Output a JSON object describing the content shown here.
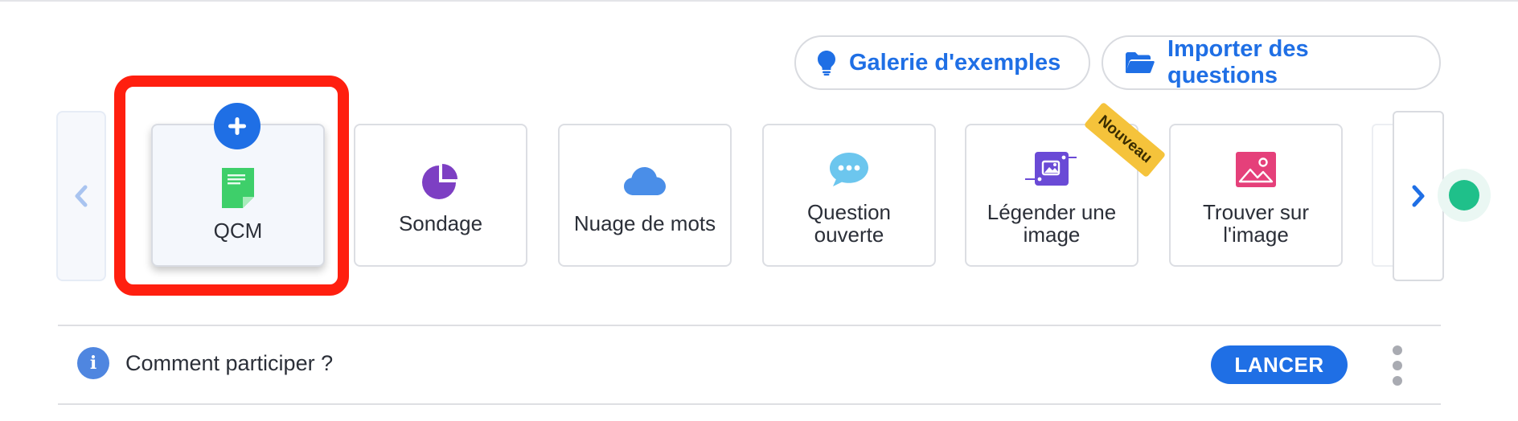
{
  "toolbar": {
    "gallery_label": "Galerie d'exemples",
    "import_label": "Importer des questions",
    "gallery_icon": "lightbulb-icon",
    "import_icon": "folder-open-icon"
  },
  "question_types": [
    {
      "label": "QCM",
      "icon": "document-icon",
      "selected": true
    },
    {
      "label": "Sondage",
      "icon": "pie-chart-icon"
    },
    {
      "label": "Nuage de mots",
      "icon": "cloud-icon"
    },
    {
      "label": "Question\nouverte",
      "icon": "speech-bubble-icon"
    },
    {
      "label": "Légender une\nimage",
      "icon": "image-label-icon",
      "badge": "Nouveau"
    },
    {
      "label": "Trouver sur\nl'image",
      "icon": "image-icon"
    }
  ],
  "navigation": {
    "prev_icon": "chevron-left-icon",
    "next_icon": "chevron-right-icon"
  },
  "footer": {
    "info_icon_glyph": "i",
    "info_text": "Comment participer ?",
    "launch_label": "LANCER"
  },
  "colors": {
    "accent": "#1f6fe5",
    "highlight": "#ff1f0f",
    "badge": "#f5c33b",
    "status": "#1fc08a"
  }
}
